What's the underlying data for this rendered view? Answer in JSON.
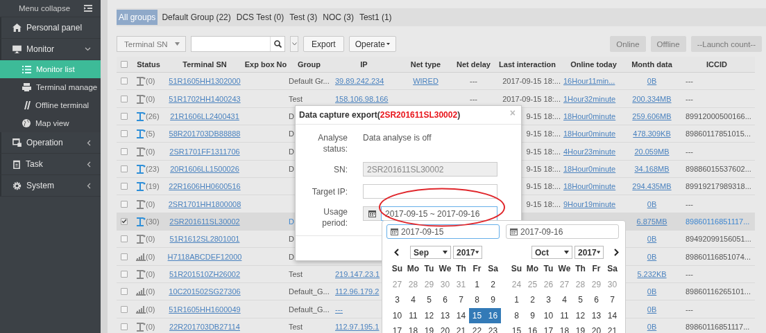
{
  "sidebar": {
    "collapse_label": "Menu collapse",
    "items": [
      {
        "label": "Personal panel",
        "selected": false
      },
      {
        "label": "Monitor",
        "selected": false,
        "expanded": true,
        "children": [
          {
            "label": "Monitor list",
            "selected": true
          },
          {
            "label": "Terminal manage",
            "selected": false
          },
          {
            "label": "Offline terminal",
            "selected": false
          },
          {
            "label": "Map view",
            "selected": false
          }
        ]
      },
      {
        "label": "Operation",
        "selected": false,
        "expanded": false
      },
      {
        "label": "Task",
        "selected": false,
        "expanded": false
      },
      {
        "label": "System",
        "selected": false,
        "expanded": false
      }
    ]
  },
  "group_tabs": [
    {
      "label": "All groups",
      "selected": true
    },
    {
      "label": "Default Group (22)",
      "selected": false
    },
    {
      "label": "DCS Test (0)",
      "selected": false
    },
    {
      "label": "Test (3)",
      "selected": false
    },
    {
      "label": "NOC (3)",
      "selected": false
    },
    {
      "label": "Test1 (1)",
      "selected": false
    }
  ],
  "toolbar": {
    "search_by": "Terminal SN",
    "buttons": [
      "Export"
    ],
    "menu_button": "Operate",
    "right_buttons": [
      "Online",
      "Offline",
      "--Launch count--"
    ]
  },
  "table": {
    "select_all": false,
    "columns": [
      "Status",
      "Terminal SN",
      "Exp box No",
      "Group",
      "IP",
      "Net type",
      "Net delay",
      "Last interaction",
      "Online today",
      "Month data",
      "ICCID"
    ],
    "rows": [
      {
        "checked": false,
        "selected": false,
        "status": {
          "kind": "tower",
          "active": false,
          "count": "(0)"
        },
        "sn": "51R1605HH1302000",
        "group": "Default Gr...",
        "ip": "39.89.242.234",
        "net_type": "WIRED",
        "net_delay": "---",
        "last_interaction": "2017-09-15 18:...",
        "online_today": "16Hour11min...",
        "month_data": "0B",
        "iccid": "---"
      },
      {
        "checked": false,
        "selected": false,
        "status": {
          "kind": "tower",
          "active": false,
          "count": "(0)"
        },
        "sn": "51R1702HH1400243",
        "group": "Test",
        "ip": "158.106.98.166",
        "net_delay": "---",
        "last_interaction": "2017-09-15 18:...",
        "online_today": "1Hour32minute",
        "month_data": "200.334MB",
        "iccid": "---"
      },
      {
        "checked": false,
        "selected": false,
        "status": {
          "kind": "tower",
          "active": true,
          "count": "(26)"
        },
        "sn": "21R1606LL2400431",
        "group": "D",
        "last_interaction": "9-15 18:...",
        "online_today": "18Hour0minute",
        "month_data": "259.606MB",
        "iccid": "89912000500166..."
      },
      {
        "checked": false,
        "selected": false,
        "status": {
          "kind": "tower",
          "active": true,
          "count": "(5)"
        },
        "sn": "58R201703DB88888",
        "group": "D",
        "last_interaction": "9-15 18:...",
        "online_today": "18Hour0minute",
        "month_data": "478.309KB",
        "iccid": "89860117851015..."
      },
      {
        "checked": false,
        "selected": false,
        "status": {
          "kind": "tower",
          "active": false,
          "count": "(0)"
        },
        "sn": "2SR1701FF1311706",
        "group": "D",
        "last_interaction": "9-15 18:...",
        "online_today": "4Hour23minute",
        "month_data": "20.059MB",
        "iccid": "---"
      },
      {
        "checked": false,
        "selected": false,
        "status": {
          "kind": "tower",
          "active": true,
          "count": "(23)"
        },
        "sn": "20R1606LL1500026",
        "group": "D",
        "last_interaction": "9-15 18:...",
        "online_today": "18Hour0minute",
        "month_data": "34.168MB",
        "iccid": "89886015537602..."
      },
      {
        "checked": false,
        "selected": false,
        "status": {
          "kind": "tower",
          "active": true,
          "count": "(19)"
        },
        "sn": "22R1606HH0600516",
        "last_interaction": "9-15 18:...",
        "online_today": "18Hour0minute",
        "month_data": "294.435MB",
        "iccid": "89919217989318..."
      },
      {
        "checked": false,
        "selected": false,
        "status": {
          "kind": "tower",
          "active": false,
          "count": "(0)"
        },
        "sn": "2SR1701HH1800008",
        "last_interaction": "9-15 18:...",
        "online_today": "9Hour19minute",
        "month_data": "0B",
        "iccid": "---"
      },
      {
        "checked": true,
        "selected": true,
        "status": {
          "kind": "tower",
          "active": true,
          "count": "(30)"
        },
        "sn": "2SR201611SL30002",
        "group": "D",
        "month_data": "6.875MB",
        "iccid": "89860116851117..."
      },
      {
        "checked": false,
        "selected": false,
        "status": {
          "kind": "tower",
          "active": false,
          "count": "(0)"
        },
        "sn": "51R1612SL2801001",
        "group": "D",
        "month_data": "0B",
        "iccid": "89492099156051..."
      },
      {
        "checked": false,
        "selected": false,
        "status": {
          "kind": "signal",
          "active": false,
          "count": "(0)"
        },
        "sn": "H7118ABCDEF12000",
        "group": "D",
        "month_data": "0B",
        "iccid": "89860116851074..."
      },
      {
        "checked": false,
        "selected": false,
        "status": {
          "kind": "tower",
          "active": false,
          "count": "(0)"
        },
        "sn": "51R201510ZH26002",
        "group": "Test",
        "ip": "219.147.23.1",
        "month_data": "5.232KB",
        "iccid": "---"
      },
      {
        "checked": false,
        "selected": false,
        "status": {
          "kind": "signal",
          "active": false,
          "count": "(0)"
        },
        "sn": "10C201502SG27306",
        "group": "Default_G...",
        "ip": "112.96.179.2",
        "month_data": "0B",
        "iccid": "89860116265101..."
      },
      {
        "checked": false,
        "selected": false,
        "status": {
          "kind": "signal",
          "active": false,
          "count": "(0)"
        },
        "sn": "51R1605HH1600049",
        "group": "Default_G...",
        "ip": "---",
        "month_data": "0B",
        "iccid": "---"
      },
      {
        "checked": false,
        "selected": false,
        "status": {
          "kind": "tower",
          "active": false,
          "count": "(0)"
        },
        "sn": "22R201703DB27114",
        "group": "Test",
        "ip": "112.97.195.1",
        "month_data": "0B",
        "iccid": "89860116851117..."
      }
    ]
  },
  "dialog": {
    "title": "Data capture export(",
    "title_sn": "2SR201611SL30002",
    "title_end": ")",
    "close": "×",
    "analyse_label": "Analyse status:",
    "analyse_value": "Data analyse is off",
    "sn_label": "SN:",
    "sn_value": "2SR201611SL30002",
    "target_label": "Target IP:",
    "period_label": "Usage period:",
    "period_value": "2017-09-15 ~ 2017-09-16",
    "period_focused": true
  },
  "calendar": {
    "inputs": [
      {
        "value": "2017-09-15",
        "focused": true
      },
      {
        "value": "2017-09-16",
        "focused": false
      }
    ],
    "months": [
      {
        "month": "Sep",
        "year": "2017",
        "weekdays": [
          "Su",
          "Mo",
          "Tu",
          "We",
          "Th",
          "Fr",
          "Sa"
        ],
        "weeks": [
          [
            {
              "day": "27",
              "other_month": true,
              "selected": false
            },
            {
              "day": "28",
              "other_month": true,
              "selected": false
            },
            {
              "day": "29",
              "other_month": true,
              "selected": false
            },
            {
              "day": "30",
              "other_month": true,
              "selected": false
            },
            {
              "day": "31",
              "other_month": true,
              "selected": false
            },
            {
              "day": "1",
              "other_month": false,
              "selected": false
            },
            {
              "day": "2",
              "other_month": false,
              "selected": false
            }
          ],
          [
            {
              "day": "3",
              "other_month": false,
              "selected": false
            },
            {
              "day": "4",
              "other_month": false,
              "selected": false
            },
            {
              "day": "5",
              "other_month": false,
              "selected": false
            },
            {
              "day": "6",
              "other_month": false,
              "selected": false
            },
            {
              "day": "7",
              "other_month": false,
              "selected": false
            },
            {
              "day": "8",
              "other_month": false,
              "selected": false
            },
            {
              "day": "9",
              "other_month": false,
              "selected": false
            }
          ],
          [
            {
              "day": "10",
              "other_month": false,
              "selected": false
            },
            {
              "day": "11",
              "other_month": false,
              "selected": false
            },
            {
              "day": "12",
              "other_month": false,
              "selected": false
            },
            {
              "day": "13",
              "other_month": false,
              "selected": false
            },
            {
              "day": "14",
              "other_month": false,
              "selected": false
            },
            {
              "day": "15",
              "other_month": false,
              "selected": true
            },
            {
              "day": "16",
              "other_month": false,
              "selected": true
            }
          ],
          [
            {
              "day": "17",
              "other_month": false,
              "selected": false
            },
            {
              "day": "18",
              "other_month": false,
              "selected": false
            },
            {
              "day": "19",
              "other_month": false,
              "selected": false
            },
            {
              "day": "20",
              "other_month": false,
              "selected": false
            },
            {
              "day": "21",
              "other_month": false,
              "selected": false
            },
            {
              "day": "22",
              "other_month": false,
              "selected": false
            },
            {
              "day": "23",
              "other_month": false,
              "selected": false
            }
          ]
        ]
      },
      {
        "month": "Oct",
        "year": "2017",
        "weekdays": [
          "Su",
          "Mo",
          "Tu",
          "We",
          "Th",
          "Fr",
          "Sa"
        ],
        "weeks": [
          [
            {
              "day": "24",
              "other_month": true,
              "selected": false
            },
            {
              "day": "25",
              "other_month": true,
              "selected": false
            },
            {
              "day": "26",
              "other_month": true,
              "selected": false
            },
            {
              "day": "27",
              "other_month": true,
              "selected": false
            },
            {
              "day": "28",
              "other_month": true,
              "selected": false
            },
            {
              "day": "29",
              "other_month": true,
              "selected": false
            },
            {
              "day": "30",
              "other_month": true,
              "selected": false
            }
          ],
          [
            {
              "day": "1",
              "other_month": false,
              "selected": false
            },
            {
              "day": "2",
              "other_month": false,
              "selected": false
            },
            {
              "day": "3",
              "other_month": false,
              "selected": false
            },
            {
              "day": "4",
              "other_month": false,
              "selected": false
            },
            {
              "day": "5",
              "other_month": false,
              "selected": false
            },
            {
              "day": "6",
              "other_month": false,
              "selected": false
            },
            {
              "day": "7",
              "other_month": false,
              "selected": false
            }
          ],
          [
            {
              "day": "8",
              "other_month": false,
              "selected": false
            },
            {
              "day": "9",
              "other_month": false,
              "selected": false
            },
            {
              "day": "10",
              "other_month": false,
              "selected": false
            },
            {
              "day": "11",
              "other_month": false,
              "selected": false
            },
            {
              "day": "12",
              "other_month": false,
              "selected": false
            },
            {
              "day": "13",
              "other_month": false,
              "selected": false
            },
            {
              "day": "14",
              "other_month": false,
              "selected": false
            }
          ],
          [
            {
              "day": "15",
              "other_month": false,
              "selected": false
            },
            {
              "day": "16",
              "other_month": false,
              "selected": false
            },
            {
              "day": "17",
              "other_month": false,
              "selected": false
            },
            {
              "day": "18",
              "other_month": false,
              "selected": false
            },
            {
              "day": "19",
              "other_month": false,
              "selected": false
            },
            {
              "day": "20",
              "other_month": false,
              "selected": false
            },
            {
              "day": "21",
              "other_month": false,
              "selected": false
            }
          ]
        ]
      }
    ]
  }
}
